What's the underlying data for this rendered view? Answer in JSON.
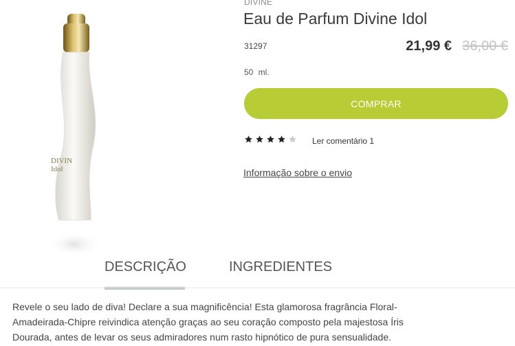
{
  "product": {
    "brand": "DIVINE",
    "title": "Eau de Parfum Divine Idol",
    "sku": "31297",
    "price": "21,99 €",
    "old_price": "36,00 €",
    "volume": "50 ml.",
    "bottle_label": "DIVIN Idol"
  },
  "actions": {
    "buy_label": "COMPRAR",
    "reviews_label": "Ler comentário 1",
    "shipping_label": "Informação sobre o envio"
  },
  "rating": {
    "value": 4,
    "max": 5
  },
  "tabs": [
    {
      "label": "DESCRIÇÃO",
      "active": true
    },
    {
      "label": "INGREDIENTES",
      "active": false
    }
  ],
  "description": "Revele o seu lado de diva! Declare a sua magnificência! Esta glamorosa fragrância Floral-Amadeirada-Chipre reivindica atenção graças ao seu coração composto pela majestosa Íris Dourada, antes de levar os seus admiradores num rasto hipnótico de pura sensualidade.",
  "colors": {
    "accent": "#b7cc35",
    "tab_underline": "#b7c4b7",
    "star_filled": "#222222",
    "star_empty": "#cccccc"
  }
}
